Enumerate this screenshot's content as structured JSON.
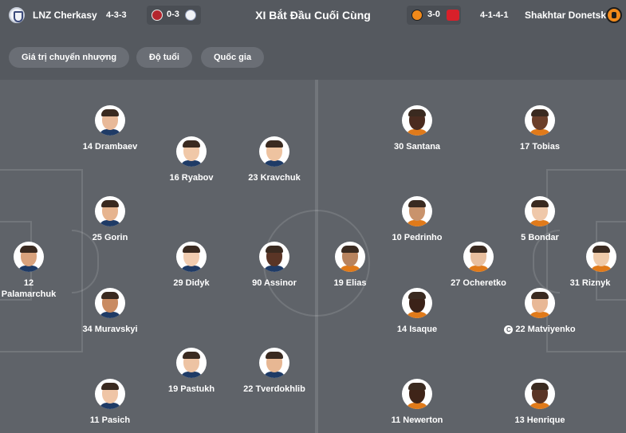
{
  "home": {
    "name": "LNZ Cherkasy",
    "formation": "4-3-3",
    "last_result": "0-3"
  },
  "away": {
    "name": "Shakhtar Donetsk",
    "formation": "4-1-4-1",
    "last_result": "3-0"
  },
  "title": "XI Bắt Đầu Cuối Cùng",
  "tabs": [
    "Giá trị chuyển nhượng",
    "Độ tuổi",
    "Quốc gia"
  ],
  "home_players": [
    {
      "label": "14 Drambaev"
    },
    {
      "label": "16 Ryabov"
    },
    {
      "label": "23 Kravchuk"
    },
    {
      "label": "25 Gorin"
    },
    {
      "label": "12 Palamarchuk"
    },
    {
      "label": "29 Didyk"
    },
    {
      "label": "90 Assinor"
    },
    {
      "label": "34 Muravskyi"
    },
    {
      "label": "19 Pastukh"
    },
    {
      "label": "22 Tverdokhlib"
    },
    {
      "label": "11 Pasich"
    }
  ],
  "away_players": [
    {
      "label": "30 Santana"
    },
    {
      "label": "17 Tobias"
    },
    {
      "label": "10 Pedrinho"
    },
    {
      "label": "5 Bondar"
    },
    {
      "label": "19 Elias"
    },
    {
      "label": "27 Ocheretko"
    },
    {
      "label": "31 Riznyk"
    },
    {
      "label": "14 Isaque"
    },
    {
      "label": "22 Matviyenko",
      "captain": "C"
    },
    {
      "label": "11 Newerton"
    },
    {
      "label": "13 Henrique"
    }
  ]
}
